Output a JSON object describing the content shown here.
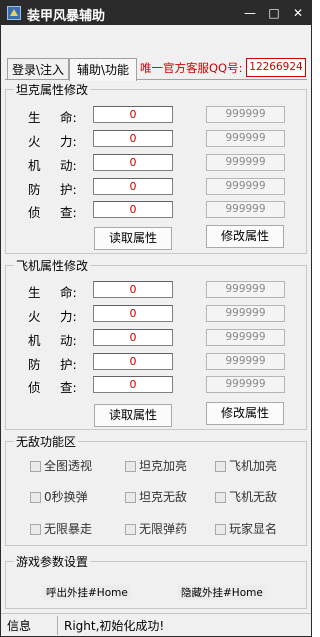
{
  "window": {
    "title": "装甲风暴辅助",
    "controls": {
      "minimize": "—",
      "maximize": "□",
      "close": "✕"
    }
  },
  "tabs": [
    {
      "label": "登录\\注入",
      "active": false
    },
    {
      "label": "辅助\\功能",
      "active": true
    }
  ],
  "banner": {
    "text": "唯一官方客服QQ号:",
    "qq": "12266924"
  },
  "tank": {
    "title": "坦克属性修改",
    "rows": [
      {
        "c1": "生",
        "c2": "命:",
        "value": "0",
        "placeholder": "999999"
      },
      {
        "c1": "火",
        "c2": "力:",
        "value": "0",
        "placeholder": "999999"
      },
      {
        "c1": "机",
        "c2": "动:",
        "value": "0",
        "placeholder": "999999"
      },
      {
        "c1": "防",
        "c2": "护:",
        "value": "0",
        "placeholder": "999999"
      },
      {
        "c1": "侦",
        "c2": "查:",
        "value": "0",
        "placeholder": "999999"
      }
    ],
    "read_button": "读取属性",
    "modify_button": "修改属性"
  },
  "plane": {
    "title": "飞机属性修改",
    "rows": [
      {
        "c1": "生",
        "c2": "命:",
        "value": "0",
        "placeholder": "999999"
      },
      {
        "c1": "火",
        "c2": "力:",
        "value": "0",
        "placeholder": "999999"
      },
      {
        "c1": "机",
        "c2": "动:",
        "value": "0",
        "placeholder": "999999"
      },
      {
        "c1": "防",
        "c2": "护:",
        "value": "0",
        "placeholder": "999999"
      },
      {
        "c1": "侦",
        "c2": "查:",
        "value": "0",
        "placeholder": "999999"
      }
    ],
    "read_button": "读取属性",
    "modify_button": "修改属性"
  },
  "invincible": {
    "title": "无敌功能区",
    "options": [
      "全图透视",
      "坦克加亮",
      "飞机加亮",
      "0秒换弹",
      "坦克无敌",
      "飞机无敌",
      "无限暴走",
      "无限弹药",
      "玩家显名"
    ]
  },
  "game_params": {
    "title": "游戏参数设置",
    "show_hotkey": "呼出外挂#Home",
    "hide_hotkey": "隐藏外挂#Home"
  },
  "status": {
    "label": "信息",
    "message": "Right,初始化成功!"
  },
  "colors": {
    "titlebar": "#2b2b2b",
    "value_text": "#d00000",
    "banner_text": "#d00000"
  }
}
